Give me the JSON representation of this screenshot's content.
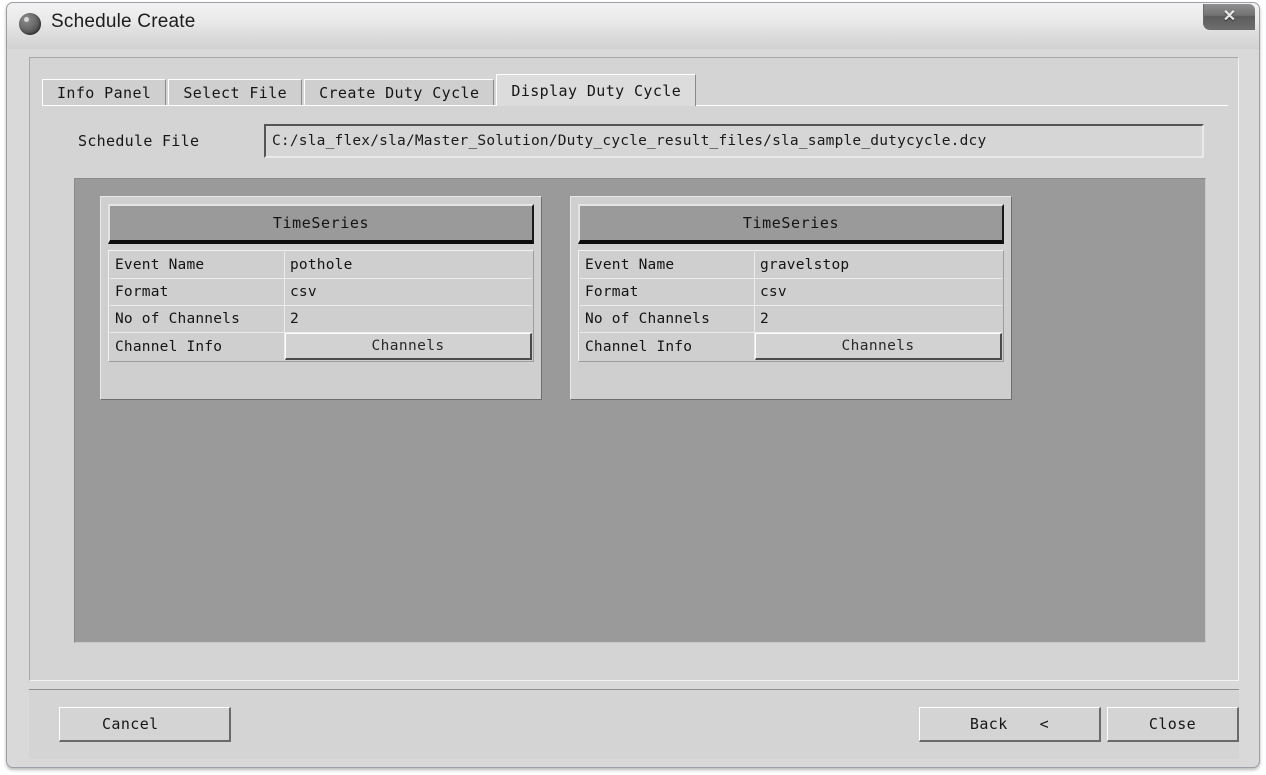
{
  "window": {
    "title": "Schedule Create",
    "icon": "sphere-icon",
    "close_glyph": "✕"
  },
  "tabs": [
    {
      "label": "Info Panel",
      "active": false
    },
    {
      "label": "Select File",
      "active": false
    },
    {
      "label": "Create Duty Cycle",
      "active": false
    },
    {
      "label": "Display Duty Cycle",
      "active": true
    }
  ],
  "schedule_file": {
    "label": "Schedule File",
    "value": "C:/sla_flex/sla/Master_Solution/Duty_cycle_result_files/sla_sample_dutycycle.dcy"
  },
  "panels": [
    {
      "header": "TimeSeries",
      "rows": [
        {
          "key": "Event Name",
          "value": "pothole",
          "type": "text"
        },
        {
          "key": "Format",
          "value": "csv",
          "type": "text"
        },
        {
          "key": "No of Channels",
          "value": "2",
          "type": "text"
        },
        {
          "key": "Channel Info",
          "value": "Channels",
          "type": "button"
        }
      ]
    },
    {
      "header": "TimeSeries",
      "rows": [
        {
          "key": "Event Name",
          "value": "gravelstop",
          "type": "text"
        },
        {
          "key": "Format",
          "value": "csv",
          "type": "text"
        },
        {
          "key": "No of Channels",
          "value": "2",
          "type": "text"
        },
        {
          "key": "Channel Info",
          "value": "Channels",
          "type": "button"
        }
      ]
    }
  ],
  "buttons": {
    "cancel": "Cancel",
    "back": "Back",
    "back_chevron": "<",
    "close": "Close"
  },
  "colors": {
    "dialog_face": "#d4d4d4",
    "canvas": "#9a9a9a",
    "panel_face": "#cfcfcf",
    "header_face": "#9a9a9a",
    "text": "#141414"
  }
}
